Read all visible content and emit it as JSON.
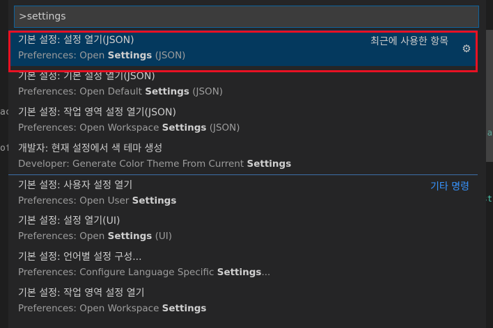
{
  "background": {
    "left_fragments": [
      "ac",
      "of"
    ],
    "right_fragments": [
      ".a",
      "st",
      "{"
    ]
  },
  "search": {
    "value": ">settings"
  },
  "items": [
    {
      "label": "기본 설정: 설정 열기(JSON)",
      "detail_pre": "Preferences: Open ",
      "detail_bold": "Settings",
      "detail_post": " (JSON)",
      "tag": "최근에 사용한 항목"
    },
    {
      "label": "기본 설정: 기본 설정 열기(JSON)",
      "detail_pre": "Preferences: Open Default ",
      "detail_bold": "Settings",
      "detail_post": " (JSON)"
    },
    {
      "label": "기본 설정: 작업 영역 설정 열기(JSON)",
      "detail_pre": "Preferences: Open Workspace ",
      "detail_bold": "Settings",
      "detail_post": " (JSON)"
    },
    {
      "label": "개발자: 현재 설정에서 색 테마 생성",
      "detail_pre": "Developer: Generate Color Theme From Current ",
      "detail_bold": "Settings",
      "detail_post": ""
    },
    {
      "label": "기본 설정: 사용자 설정 열기",
      "detail_pre": "Preferences: Open User ",
      "detail_bold": "Settings",
      "detail_post": "",
      "tag": "기타 명령"
    },
    {
      "label": "기본 설정: 설정 열기(UI)",
      "detail_pre": "Preferences: Open ",
      "detail_bold": "Settings",
      "detail_post": " (UI)"
    },
    {
      "label": "기본 설정: 언어별 설정 구성...",
      "detail_pre": "Preferences: Configure Language Specific ",
      "detail_bold": "Settings",
      "detail_post": "..."
    },
    {
      "label": "기본 설정: 작업 영역 설정 열기",
      "detail_pre": "Preferences: Open Workspace ",
      "detail_bold": "Settings",
      "detail_post": ""
    }
  ],
  "icons": {
    "configure": "gear-icon"
  },
  "colors": {
    "accent": "#0e639c",
    "selection": "#04395e",
    "highlight_box": "#e81123",
    "tag_link": "#3794ff"
  }
}
